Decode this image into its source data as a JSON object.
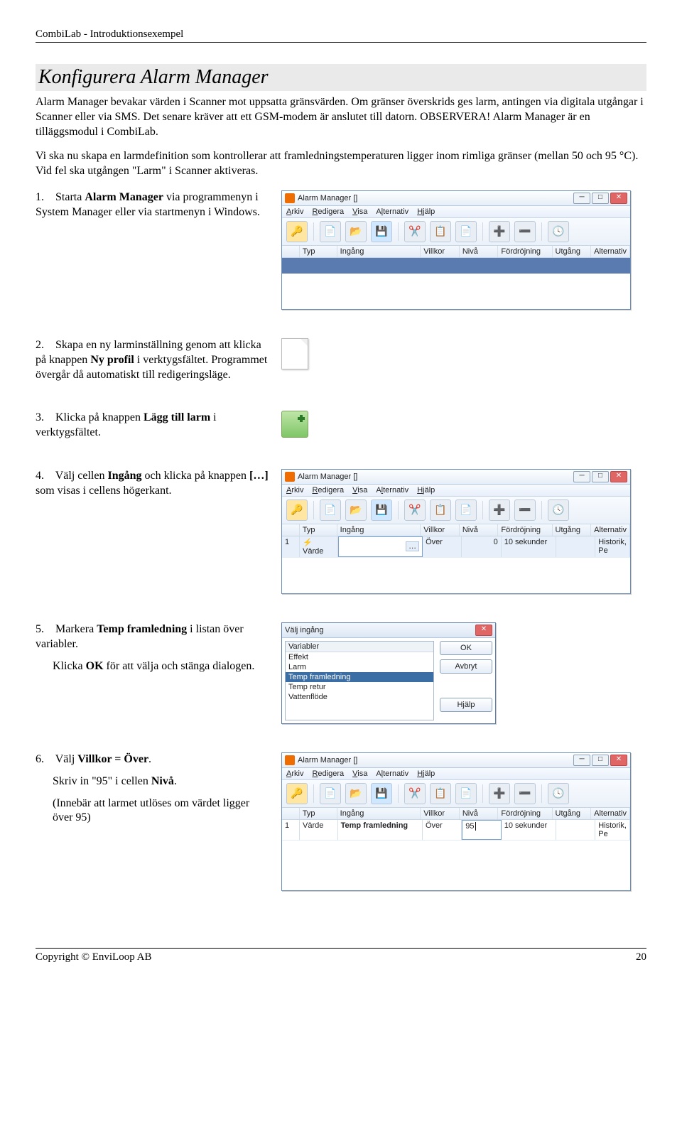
{
  "header": "CombiLab - Introduktionsexempel",
  "section_title": "Konfigurera Alarm Manager",
  "intro": "Alarm Manager bevakar värden i Scanner mot uppsatta gränsvärden. Om gränser överskrids ges larm, antingen via digitala utgångar i Scanner eller via SMS. Det senare kräver att ett GSM-modem är anslutet till datorn. OBSERVERA! Alarm Manager är en tilläggsmodul i CombiLab.",
  "sub": "Vi ska nu skapa en larmdefinition som kontrollerar att framledningstemperaturen ligger inom rimliga gränser (mellan 50 och 95 °C). Vid fel ska utgången \"Larm\" i Scanner aktiveras.",
  "steps": {
    "s1_num": "1.",
    "s1_a": "Starta ",
    "s1_b": "Alarm Manager",
    "s1_c": " via programmenyn i System Manager eller via startmenyn i Windows.",
    "s2_num": "2.",
    "s2_a": "Skapa en ny larminställning genom att klicka på knappen ",
    "s2_b": "Ny profil",
    "s2_c": " i verktygsfältet. Programmet övergår då automatiskt till redigeringsläge.",
    "s3_num": "3.",
    "s3_a": "Klicka på knappen ",
    "s3_b": "Lägg till larm",
    "s3_c": " i verktygsfältet.",
    "s4_num": "4.",
    "s4_a": "Välj cellen ",
    "s4_b": "Ingång",
    "s4_c": " och klicka på knappen ",
    "s4_d": "[…]",
    "s4_e": " som visas i cellens högerkant.",
    "s5_num": "5.",
    "s5_a": "Markera ",
    "s5_b": "Temp framledning",
    "s5_c": " i listan över variabler.",
    "s5_note_a": "Klicka ",
    "s5_note_b": "OK",
    "s5_note_c": " för att välja och stänga dialogen.",
    "s6_num": "6.",
    "s6_a": "Välj ",
    "s6_b": "Villkor = Över",
    "s6_c": ".",
    "s6_note1": "Skriv in \"95\" i cellen ",
    "s6_note1b": "Nivå",
    "s6_note1c": ".",
    "s6_note2": "(Innebär att larmet utlöses om värdet ligger över 95)"
  },
  "am": {
    "title": "Alarm Manager []",
    "menus": {
      "arkiv": "Arkiv",
      "redigera": "Redigera",
      "visa": "Visa",
      "alternativ": "Alternativ",
      "hjalp": "Hjälp"
    },
    "cols": {
      "typ": "Typ",
      "ingang": "Ingång",
      "villkor": "Villkor",
      "niva": "Nivå",
      "fordrojning": "Fördröjning",
      "utgang": "Utgång",
      "alternativ": "Alternativ"
    },
    "row4": {
      "num": "1",
      "typ_icon": "⚡",
      "typ": "Värde",
      "ingang": "",
      "villkor": "Över",
      "niva": "0",
      "delay": "10 sekunder",
      "utgang": "",
      "alt": "Historik, Pe"
    },
    "row6": {
      "num": "1",
      "typ": "Värde",
      "ingang": "Temp framledning",
      "villkor": "Över",
      "niva": "95",
      "delay": "10 sekunder",
      "utgang": "",
      "alt": "Historik, Pe"
    }
  },
  "dlg": {
    "title": "Välj ingång",
    "header": "Variabler",
    "items": [
      "Effekt",
      "Larm",
      "Temp framledning",
      "Temp retur",
      "Vattenflöde"
    ],
    "btn_ok": "OK",
    "btn_cancel": "Avbryt",
    "btn_help": "Hjälp"
  },
  "footer_left": "Copyright © EnviLoop AB",
  "footer_right": "20"
}
